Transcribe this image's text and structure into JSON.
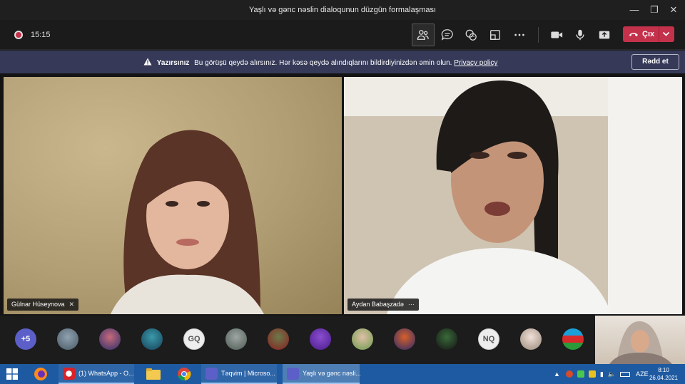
{
  "window": {
    "title": "Yaşlı və gənc nəslin dialoqunun düzgün formalaşması"
  },
  "toolbar": {
    "timer": "15:15",
    "leave_label": "Çıx",
    "buttons": [
      "people-icon",
      "chat-icon",
      "reactions-icon",
      "rooms-icon",
      "more-icon",
      "camera-icon",
      "mic-icon",
      "share-icon"
    ]
  },
  "banner": {
    "bold": "Yazırsınız",
    "message": "Bu görüşü qeydə alırsınız. Hər kəsə qeydə alındıqlarını bildirdiyinizdən əmin olun.",
    "link": "Privacy policy",
    "dismiss": "Rədd et"
  },
  "participants": [
    {
      "name": "Gülnar Hüseynova",
      "status": "muted"
    },
    {
      "name": "Aydan Babaşzadə",
      "status": "more"
    }
  ],
  "strip": {
    "more": "+5",
    "initials_1": "GQ",
    "initials_2": "NQ"
  },
  "taskbar": {
    "apps": [
      "(1) WhatsApp - O...",
      "Təqvim | Microso...",
      "Yaşlı və gənc nəsli..."
    ],
    "lang": "AZE",
    "time": "8:10",
    "date": "26.04.2021"
  },
  "colors": {
    "leave": "#c4314b",
    "banner": "#363a58",
    "taskbar": "#1e5aa1",
    "accent": "#5b5fc7"
  }
}
